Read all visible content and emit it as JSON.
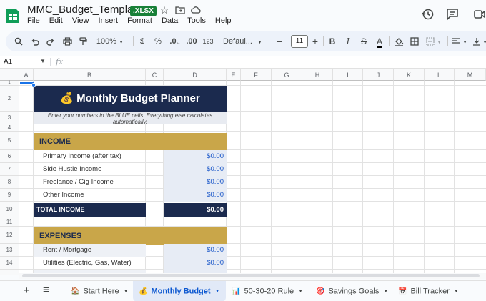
{
  "app": {
    "title": "MMC_Budget_Template",
    "badge": ".XLSX",
    "menu": [
      "File",
      "Edit",
      "View",
      "Insert",
      "Format",
      "Data",
      "Tools",
      "Help"
    ]
  },
  "toolbar": {
    "zoom": "100%",
    "currency": "$",
    "percent": "%",
    "decimal_dec": ".0",
    "decimal_inc": ".00",
    "number_format": "123",
    "font": "Defaul...",
    "font_size": "11"
  },
  "formula_bar": {
    "cell_ref": "A1",
    "fx": "fx"
  },
  "grid": {
    "columns": [
      "A",
      "B",
      "C",
      "D",
      "E",
      "F",
      "G",
      "H",
      "I",
      "J",
      "K",
      "L",
      "M"
    ],
    "rows": [
      "1",
      "2",
      "3",
      "4",
      "5",
      "6",
      "7",
      "8",
      "9",
      "10",
      "11",
      "12",
      "13",
      "14"
    ]
  },
  "sheet": {
    "title": "💰 Monthly Budget Planner",
    "subtitle": "Enter your numbers in the BLUE cells. Everything else calculates automatically.",
    "income_header": "INCOME",
    "income_items": [
      {
        "label": "Primary Income (after tax)",
        "value": "$0.00"
      },
      {
        "label": "Side Hustle Income",
        "value": "$0.00"
      },
      {
        "label": "Freelance / Gig Income",
        "value": "$0.00"
      },
      {
        "label": "Other Income",
        "value": "$0.00"
      }
    ],
    "total_income_label": "TOTAL INCOME",
    "total_income_value": "$0.00",
    "expenses_header": "EXPENSES",
    "expense_items": [
      {
        "label": "Rent / Mortgage",
        "value": "$0.00"
      },
      {
        "label": "Utilities (Electric, Gas, Water)",
        "value": "$0.00"
      }
    ]
  },
  "tabs": [
    {
      "emoji": "🏠",
      "label": "Start Here"
    },
    {
      "emoji": "💰",
      "label": "Monthly Budget"
    },
    {
      "emoji": "📊",
      "label": "50-30-20 Rule"
    },
    {
      "emoji": "🎯",
      "label": "Savings Goals"
    },
    {
      "emoji": "📅",
      "label": "Bill Tracker"
    }
  ],
  "colors": {
    "navy": "#1b2a4e",
    "gold": "#c9a649",
    "input_blue": "#1a57c9",
    "active_tab": "#0b57d0"
  }
}
